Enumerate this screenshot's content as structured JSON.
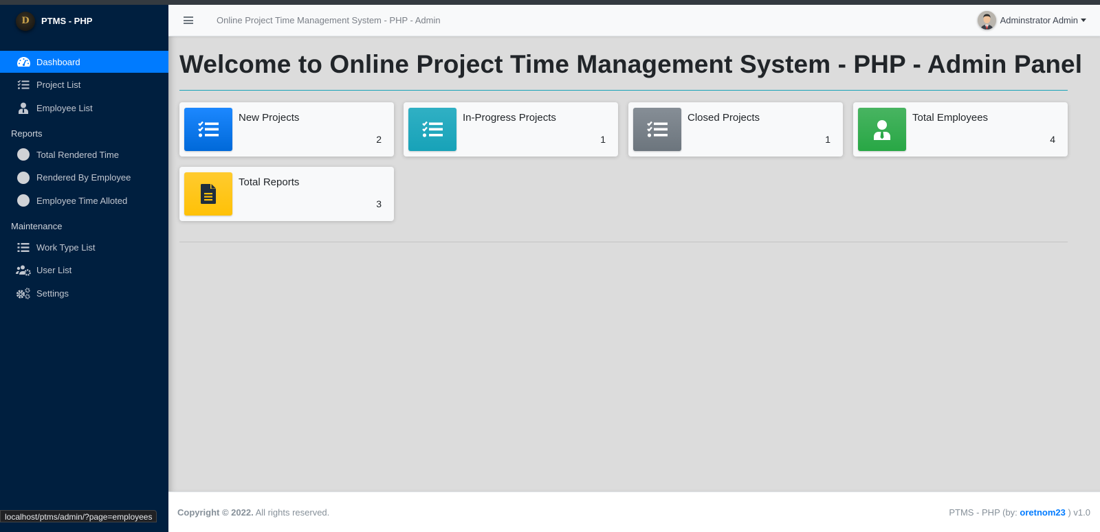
{
  "brand": {
    "logo_letter": "D",
    "name": "PTMS - PHP"
  },
  "sidebar": {
    "items": [
      {
        "label": "Dashboard",
        "icon": "tachometer-icon",
        "active": true
      },
      {
        "label": "Project List",
        "icon": "tasks-list-icon"
      },
      {
        "label": "Employee List",
        "icon": "user-tie-icon"
      }
    ],
    "reports_header": "Reports",
    "reports": [
      {
        "label": "Total Rendered Time",
        "icon": "circle-icon"
      },
      {
        "label": "Rendered By Employee",
        "icon": "circle-icon"
      },
      {
        "label": "Employee Time Alloted",
        "icon": "circle-icon"
      }
    ],
    "maintenance_header": "Maintenance",
    "maintenance": [
      {
        "label": "Work Type List",
        "icon": "list-icon"
      },
      {
        "label": "User List",
        "icon": "users-cog-icon"
      },
      {
        "label": "Settings",
        "icon": "cogs-icon"
      }
    ]
  },
  "navbar": {
    "title": "Online Project Time Management System - PHP - Admin",
    "user_name": "Adminstrator Admin"
  },
  "main": {
    "title": "Welcome to Online Project Time Management System - PHP - Admin Panel",
    "cards": [
      {
        "label": "New Projects",
        "value": "2",
        "icon": "tasks-icon",
        "color": "#007bff"
      },
      {
        "label": "In-Progress Projects",
        "value": "1",
        "icon": "tasks-icon",
        "color": "#17a2b8"
      },
      {
        "label": "Closed Projects",
        "value": "1",
        "icon": "tasks-icon",
        "color": "#6c757d"
      },
      {
        "label": "Total Employees",
        "value": "4",
        "icon": "user-tie-icon",
        "color": "#28a745"
      },
      {
        "label": "Total Reports",
        "value": "3",
        "icon": "file-alt-icon",
        "color": "#ffc107"
      }
    ]
  },
  "footer": {
    "copyright_prefix": "Copyright © 2022.",
    "copyright_suffix": " All rights reserved.",
    "credit_prefix": "PTMS - PHP (by: ",
    "credit_author": "oretnom23",
    "credit_suffix": " ) v1.0"
  },
  "status_url": "localhost/ptms/admin/?page=employees"
}
